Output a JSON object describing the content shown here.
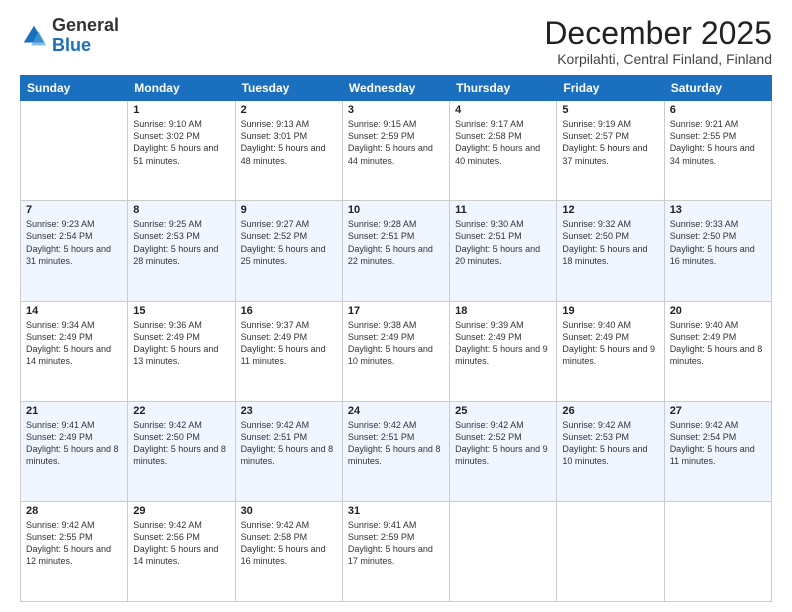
{
  "logo": {
    "general": "General",
    "blue": "Blue"
  },
  "header": {
    "title": "December 2025",
    "subtitle": "Korpilahti, Central Finland, Finland"
  },
  "days_of_week": [
    "Sunday",
    "Monday",
    "Tuesday",
    "Wednesday",
    "Thursday",
    "Friday",
    "Saturday"
  ],
  "weeks": [
    [
      {
        "day": "",
        "sunrise": "",
        "sunset": "",
        "daylight": ""
      },
      {
        "day": "1",
        "sunrise": "Sunrise: 9:10 AM",
        "sunset": "Sunset: 3:02 PM",
        "daylight": "Daylight: 5 hours and 51 minutes."
      },
      {
        "day": "2",
        "sunrise": "Sunrise: 9:13 AM",
        "sunset": "Sunset: 3:01 PM",
        "daylight": "Daylight: 5 hours and 48 minutes."
      },
      {
        "day": "3",
        "sunrise": "Sunrise: 9:15 AM",
        "sunset": "Sunset: 2:59 PM",
        "daylight": "Daylight: 5 hours and 44 minutes."
      },
      {
        "day": "4",
        "sunrise": "Sunrise: 9:17 AM",
        "sunset": "Sunset: 2:58 PM",
        "daylight": "Daylight: 5 hours and 40 minutes."
      },
      {
        "day": "5",
        "sunrise": "Sunrise: 9:19 AM",
        "sunset": "Sunset: 2:57 PM",
        "daylight": "Daylight: 5 hours and 37 minutes."
      },
      {
        "day": "6",
        "sunrise": "Sunrise: 9:21 AM",
        "sunset": "Sunset: 2:55 PM",
        "daylight": "Daylight: 5 hours and 34 minutes."
      }
    ],
    [
      {
        "day": "7",
        "sunrise": "Sunrise: 9:23 AM",
        "sunset": "Sunset: 2:54 PM",
        "daylight": "Daylight: 5 hours and 31 minutes."
      },
      {
        "day": "8",
        "sunrise": "Sunrise: 9:25 AM",
        "sunset": "Sunset: 2:53 PM",
        "daylight": "Daylight: 5 hours and 28 minutes."
      },
      {
        "day": "9",
        "sunrise": "Sunrise: 9:27 AM",
        "sunset": "Sunset: 2:52 PM",
        "daylight": "Daylight: 5 hours and 25 minutes."
      },
      {
        "day": "10",
        "sunrise": "Sunrise: 9:28 AM",
        "sunset": "Sunset: 2:51 PM",
        "daylight": "Daylight: 5 hours and 22 minutes."
      },
      {
        "day": "11",
        "sunrise": "Sunrise: 9:30 AM",
        "sunset": "Sunset: 2:51 PM",
        "daylight": "Daylight: 5 hours and 20 minutes."
      },
      {
        "day": "12",
        "sunrise": "Sunrise: 9:32 AM",
        "sunset": "Sunset: 2:50 PM",
        "daylight": "Daylight: 5 hours and 18 minutes."
      },
      {
        "day": "13",
        "sunrise": "Sunrise: 9:33 AM",
        "sunset": "Sunset: 2:50 PM",
        "daylight": "Daylight: 5 hours and 16 minutes."
      }
    ],
    [
      {
        "day": "14",
        "sunrise": "Sunrise: 9:34 AM",
        "sunset": "Sunset: 2:49 PM",
        "daylight": "Daylight: 5 hours and 14 minutes."
      },
      {
        "day": "15",
        "sunrise": "Sunrise: 9:36 AM",
        "sunset": "Sunset: 2:49 PM",
        "daylight": "Daylight: 5 hours and 13 minutes."
      },
      {
        "day": "16",
        "sunrise": "Sunrise: 9:37 AM",
        "sunset": "Sunset: 2:49 PM",
        "daylight": "Daylight: 5 hours and 11 minutes."
      },
      {
        "day": "17",
        "sunrise": "Sunrise: 9:38 AM",
        "sunset": "Sunset: 2:49 PM",
        "daylight": "Daylight: 5 hours and 10 minutes."
      },
      {
        "day": "18",
        "sunrise": "Sunrise: 9:39 AM",
        "sunset": "Sunset: 2:49 PM",
        "daylight": "Daylight: 5 hours and 9 minutes."
      },
      {
        "day": "19",
        "sunrise": "Sunrise: 9:40 AM",
        "sunset": "Sunset: 2:49 PM",
        "daylight": "Daylight: 5 hours and 9 minutes."
      },
      {
        "day": "20",
        "sunrise": "Sunrise: 9:40 AM",
        "sunset": "Sunset: 2:49 PM",
        "daylight": "Daylight: 5 hours and 8 minutes."
      }
    ],
    [
      {
        "day": "21",
        "sunrise": "Sunrise: 9:41 AM",
        "sunset": "Sunset: 2:49 PM",
        "daylight": "Daylight: 5 hours and 8 minutes."
      },
      {
        "day": "22",
        "sunrise": "Sunrise: 9:42 AM",
        "sunset": "Sunset: 2:50 PM",
        "daylight": "Daylight: 5 hours and 8 minutes."
      },
      {
        "day": "23",
        "sunrise": "Sunrise: 9:42 AM",
        "sunset": "Sunset: 2:51 PM",
        "daylight": "Daylight: 5 hours and 8 minutes."
      },
      {
        "day": "24",
        "sunrise": "Sunrise: 9:42 AM",
        "sunset": "Sunset: 2:51 PM",
        "daylight": "Daylight: 5 hours and 8 minutes."
      },
      {
        "day": "25",
        "sunrise": "Sunrise: 9:42 AM",
        "sunset": "Sunset: 2:52 PM",
        "daylight": "Daylight: 5 hours and 9 minutes."
      },
      {
        "day": "26",
        "sunrise": "Sunrise: 9:42 AM",
        "sunset": "Sunset: 2:53 PM",
        "daylight": "Daylight: 5 hours and 10 minutes."
      },
      {
        "day": "27",
        "sunrise": "Sunrise: 9:42 AM",
        "sunset": "Sunset: 2:54 PM",
        "daylight": "Daylight: 5 hours and 11 minutes."
      }
    ],
    [
      {
        "day": "28",
        "sunrise": "Sunrise: 9:42 AM",
        "sunset": "Sunset: 2:55 PM",
        "daylight": "Daylight: 5 hours and 12 minutes."
      },
      {
        "day": "29",
        "sunrise": "Sunrise: 9:42 AM",
        "sunset": "Sunset: 2:56 PM",
        "daylight": "Daylight: 5 hours and 14 minutes."
      },
      {
        "day": "30",
        "sunrise": "Sunrise: 9:42 AM",
        "sunset": "Sunset: 2:58 PM",
        "daylight": "Daylight: 5 hours and 16 minutes."
      },
      {
        "day": "31",
        "sunrise": "Sunrise: 9:41 AM",
        "sunset": "Sunset: 2:59 PM",
        "daylight": "Daylight: 5 hours and 17 minutes."
      },
      {
        "day": "",
        "sunrise": "",
        "sunset": "",
        "daylight": ""
      },
      {
        "day": "",
        "sunrise": "",
        "sunset": "",
        "daylight": ""
      },
      {
        "day": "",
        "sunrise": "",
        "sunset": "",
        "daylight": ""
      }
    ]
  ]
}
